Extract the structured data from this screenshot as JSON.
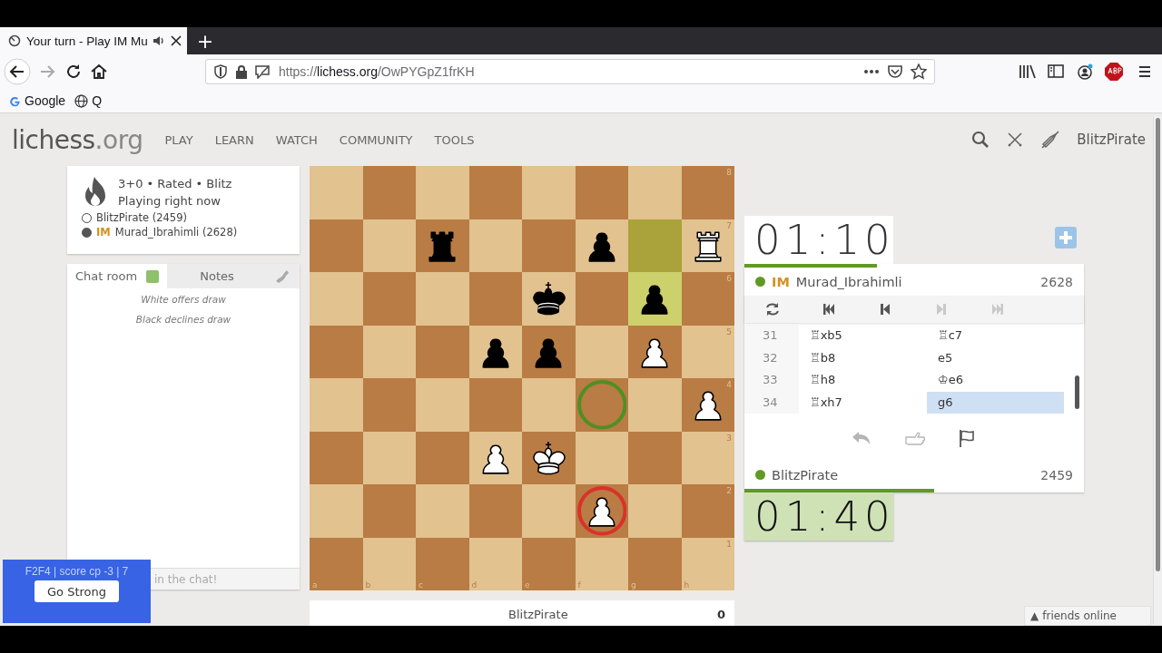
{
  "browser": {
    "tab": {
      "title": "Your turn - Play IM Mu",
      "selected": true
    },
    "new_tab": "+",
    "url": {
      "scheme": "https://",
      "domain": "lichess.org",
      "path": "/OwPYGpZ1frKH"
    },
    "bookmarks": [
      {
        "kind": "google",
        "label": "Google"
      },
      {
        "kind": "globe",
        "label": "Q"
      }
    ]
  },
  "site": {
    "logo": "lichess",
    "logo_tld": ".org",
    "nav": [
      "PLAY",
      "LEARN",
      "WATCH",
      "COMMUNITY",
      "TOOLS"
    ],
    "user": "BlitzPirate"
  },
  "game_info": {
    "title": "3+0 • Rated • Blitz",
    "subtitle": "Playing right now",
    "players": [
      {
        "kind": "white",
        "name": "BlitzPirate (2459)"
      },
      {
        "kind": "black",
        "title": "IM",
        "name": "Murad_Ibrahimli (2628)"
      }
    ]
  },
  "chat": {
    "tabs": [
      {
        "label": "Chat room",
        "selected": true
      },
      {
        "label": "Notes",
        "selected": false
      }
    ],
    "chat_enabled": true,
    "messages": [
      "White offers draw",
      "Black declines draw"
    ],
    "placeholder": "in the chat!"
  },
  "engine_overlay": {
    "info": "F2F4 | score cp -3 | 7",
    "button": "Go Strong"
  },
  "board": {
    "files": [
      "a",
      "b",
      "c",
      "d",
      "e",
      "f",
      "g",
      "h"
    ],
    "rows": [
      {
        "label": "8",
        "squares": [
          {
            "highlighted": false
          },
          {
            "highlighted": false
          },
          {
            "highlighted": false
          },
          {
            "highlighted": false
          },
          {
            "highlighted": false
          },
          {
            "highlighted": false
          },
          {
            "highlighted": false
          },
          {
            "highlighted": false
          }
        ]
      },
      {
        "label": "7",
        "squares": [
          {
            "highlighted": false
          },
          {
            "highlighted": false
          },
          {
            "highlighted": false,
            "piece": {
              "kind": "rook",
              "color": "#000000"
            }
          },
          {
            "highlighted": false
          },
          {
            "highlighted": false
          },
          {
            "highlighted": false,
            "piece": {
              "kind": "pawn",
              "color": "#000000"
            }
          },
          {
            "highlighted": true
          },
          {
            "highlighted": false,
            "piece": {
              "kind": "rook",
              "color": "#ffffff"
            }
          }
        ]
      },
      {
        "label": "6",
        "squares": [
          {
            "highlighted": false
          },
          {
            "highlighted": false
          },
          {
            "highlighted": false
          },
          {
            "highlighted": false
          },
          {
            "highlighted": false,
            "piece": {
              "kind": "king",
              "color": "#000000"
            }
          },
          {
            "highlighted": false
          },
          {
            "highlighted": true,
            "piece": {
              "kind": "pawn",
              "color": "#000000"
            }
          },
          {
            "highlighted": false
          }
        ]
      },
      {
        "label": "5",
        "squares": [
          {
            "highlighted": false
          },
          {
            "highlighted": false
          },
          {
            "highlighted": false
          },
          {
            "highlighted": false,
            "piece": {
              "kind": "pawn",
              "color": "#000000"
            }
          },
          {
            "highlighted": false,
            "piece": {
              "kind": "pawn",
              "color": "#000000"
            }
          },
          {
            "highlighted": false
          },
          {
            "highlighted": false,
            "piece": {
              "kind": "pawn",
              "color": "#ffffff"
            }
          },
          {
            "highlighted": false
          }
        ]
      },
      {
        "label": "4",
        "squares": [
          {
            "highlighted": false
          },
          {
            "highlighted": false
          },
          {
            "highlighted": false
          },
          {
            "highlighted": false
          },
          {
            "highlighted": false
          },
          {
            "highlighted": false,
            "marker": {
              "color": "#4f8f23"
            }
          },
          {
            "highlighted": false
          },
          {
            "highlighted": false,
            "piece": {
              "kind": "pawn",
              "color": "#ffffff"
            }
          }
        ]
      },
      {
        "label": "3",
        "squares": [
          {
            "highlighted": false
          },
          {
            "highlighted": false
          },
          {
            "highlighted": false
          },
          {
            "highlighted": false,
            "piece": {
              "kind": "pawn",
              "color": "#ffffff"
            }
          },
          {
            "highlighted": false,
            "piece": {
              "kind": "king",
              "color": "#ffffff"
            }
          },
          {
            "highlighted": false
          },
          {
            "highlighted": false
          },
          {
            "highlighted": false
          }
        ]
      },
      {
        "label": "2",
        "squares": [
          {
            "highlighted": false
          },
          {
            "highlighted": false
          },
          {
            "highlighted": false
          },
          {
            "highlighted": false
          },
          {
            "highlighted": false
          },
          {
            "highlighted": false,
            "piece": {
              "kind": "pawn",
              "color": "#ffffff"
            },
            "marker": {
              "color": "#d8332a"
            }
          },
          {
            "highlighted": false
          },
          {
            "highlighted": false
          }
        ]
      },
      {
        "label": "1",
        "squares": [
          {
            "highlighted": false
          },
          {
            "highlighted": false
          },
          {
            "highlighted": false
          },
          {
            "highlighted": false
          },
          {
            "highlighted": false
          },
          {
            "highlighted": false
          },
          {
            "highlighted": false
          },
          {
            "highlighted": false
          }
        ]
      }
    ]
  },
  "material_bar": {
    "player": "BlitzPirate",
    "score": "0"
  },
  "opponent_clock": {
    "time": "01:10",
    "running": false,
    "level": 0.39
  },
  "opponent": {
    "online": true,
    "title": "IM",
    "name": "Murad_Ibrahimli",
    "rating": "2628"
  },
  "controls": [
    {
      "kind": "flip",
      "disabled": false
    },
    {
      "kind": "first",
      "disabled": false
    },
    {
      "kind": "prev",
      "disabled": false
    },
    {
      "kind": "next",
      "disabled": true
    },
    {
      "kind": "last",
      "disabled": true
    }
  ],
  "moves": [
    {
      "number": "31",
      "white": {
        "san": "♖xb5",
        "selected": false
      },
      "black": {
        "san": "♖c7",
        "selected": false
      }
    },
    {
      "number": "32",
      "white": {
        "san": "♖b8",
        "selected": false
      },
      "black": {
        "san": "e5",
        "selected": false
      }
    },
    {
      "number": "33",
      "white": {
        "san": "♖h8",
        "selected": false
      },
      "black": {
        "san": "♔e6",
        "selected": false
      }
    },
    {
      "number": "34",
      "white": {
        "san": "♖xh7",
        "selected": false
      },
      "black": {
        "san": "g6",
        "selected": true
      }
    }
  ],
  "actions": [
    {
      "kind": "takeback",
      "disabled": true
    },
    {
      "kind": "draw",
      "disabled": true
    },
    {
      "kind": "resign",
      "disabled": false
    }
  ],
  "player": {
    "online": true,
    "name": "BlitzPirate",
    "rating": "2459"
  },
  "player_clock": {
    "time": "01:40",
    "running": true,
    "level": 0.56
  },
  "friends_bar": {
    "arrow": "▲",
    "label": "friends online"
  }
}
